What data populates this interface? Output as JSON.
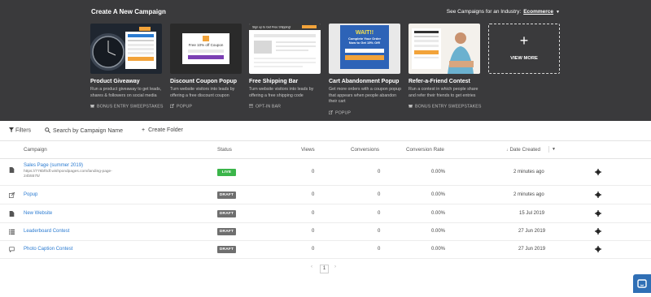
{
  "header": {
    "title": "Create A New Campaign",
    "industry_label": "See Campaigns for an Industry:",
    "industry_value": "Ecommerce"
  },
  "cards": [
    {
      "title": "Product Giveaway",
      "desc": "Run a product giveaway to get leads, shares & followers on social media",
      "tag": "BONUS ENTRY SWEEPSTAKES",
      "tag_icon": "gift-icon"
    },
    {
      "title": "Discount Coupon Popup",
      "desc": "Turn website visitors into leads by offering a free discount coupon",
      "tag": "POPUP",
      "tag_icon": "external-link-icon"
    },
    {
      "title": "Free Shipping Bar",
      "desc": "Turn website visitors into leads by offering a free shipping code",
      "tag": "OPT-IN BAR",
      "tag_icon": "bar-icon"
    },
    {
      "title": "Cart Abandonment Popup",
      "desc": "Get more orders with a coupon popup that appears when people abandon their cart",
      "tag": "POPUP",
      "tag_icon": "external-link-icon"
    },
    {
      "title": "Refer-a-Friend Contest",
      "desc": "Run a contest in which people share and refer their friends to get entries",
      "tag": "BONUS ENTRY SWEEPSTAKES",
      "tag_icon": "gift-icon"
    }
  ],
  "card_previews": {
    "coupon_text": "Free 10% off Coupon",
    "shipping_text": "Sign up to Get Free Shipping!",
    "cart_wait": "WAIT!!",
    "cart_line1": "Complete Your Order",
    "cart_line2": "Now to Get 15% Off!"
  },
  "view_more": {
    "label": "VIEW MORE"
  },
  "toolbar": {
    "filters": "Filters",
    "search_placeholder": "Search by Campaign Name",
    "create_folder": "Create Folder"
  },
  "table": {
    "headers": {
      "campaign": "Campaign",
      "status": "Status",
      "views": "Views",
      "conversions": "Conversions",
      "rate": "Conversion Rate",
      "date": "Date Created"
    },
    "rows": [
      {
        "name": "Sales Page (summer 2019)",
        "url": "https://776bf0df.wishpondpages.com/landing-page-24b5575/",
        "status": "LIVE",
        "views": "0",
        "conversions": "0",
        "rate": "0.00%",
        "date": "2 minutes ago",
        "icon": "page-icon"
      },
      {
        "name": "Popup",
        "url": "",
        "status": "DRAFT",
        "views": "0",
        "conversions": "0",
        "rate": "0.00%",
        "date": "2 minutes ago",
        "icon": "popup-icon"
      },
      {
        "name": "New Website",
        "url": "",
        "status": "DRAFT",
        "views": "0",
        "conversions": "0",
        "rate": "0.00%",
        "date": "15 Jul 2019",
        "icon": "page-icon"
      },
      {
        "name": "Leaderboard Contest",
        "url": "",
        "status": "DRAFT",
        "views": "0",
        "conversions": "0",
        "rate": "0.00%",
        "date": "27 Jun 2019",
        "icon": "list-icon"
      },
      {
        "name": "Photo Caption Contest",
        "url": "",
        "status": "DRAFT",
        "views": "0",
        "conversions": "0",
        "rate": "0.00%",
        "date": "27 Jun 2019",
        "icon": "comment-icon"
      }
    ]
  },
  "pagination": {
    "prev": "‹",
    "page": "1",
    "next": "›"
  },
  "colors": {
    "hero_bg": "#3a3a3c",
    "link": "#2b7bd1",
    "live": "#3bb54a",
    "draft": "#6f6f6f",
    "chat": "#2f6fb5"
  }
}
